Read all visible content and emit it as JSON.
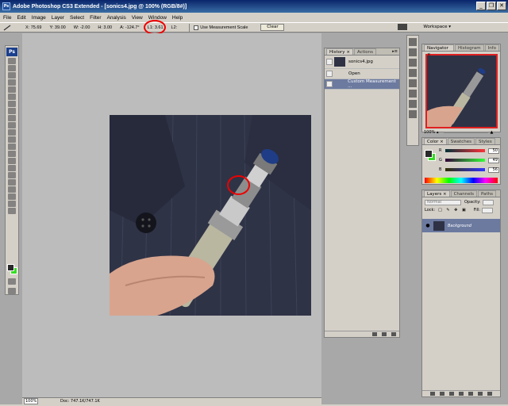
{
  "window": {
    "title": "Adobe Photoshop CS3 Extended - [sonics4.jpg @ 100% (RGB/8#)]",
    "app_icon": "Ps",
    "buttons": [
      "_",
      "❐",
      "✕"
    ]
  },
  "menu": [
    "File",
    "Edit",
    "Image",
    "Layer",
    "Select",
    "Filter",
    "Analysis",
    "View",
    "Window",
    "Help"
  ],
  "options": {
    "x": "X: 75.69",
    "y": "Y: 39.00",
    "w": "W: -2.00",
    "h": "H: 3.00",
    "a": "A: -124.7°",
    "l1": "L1: 3.61",
    "l2": "L2:",
    "use_measurement_scale": "Use Measurement Scale",
    "clear": "Clear",
    "workspace": "Workspace ▾"
  },
  "toolbox": {
    "logo": "Ps",
    "foreground": "#2a2a2a",
    "background": "#33dd22"
  },
  "status": {
    "zoom": "100%",
    "doc": "Doc: 747.1K/747.1K"
  },
  "history": {
    "tabs": [
      "History ×",
      "Actions"
    ],
    "snapshot": "sonics4.jpg",
    "items": [
      "Open",
      "Custom Measurement ..."
    ]
  },
  "navigator": {
    "tabs": [
      "Navigator ×",
      "Histogram",
      "Info"
    ],
    "zoom": "100%"
  },
  "color_panel": {
    "tabs": [
      "Color ×",
      "Swatches",
      "Styles"
    ],
    "r_label": "R",
    "r": "50",
    "g_label": "G",
    "g": "49",
    "b_label": "B",
    "b": "56"
  },
  "layers": {
    "tabs": [
      "Layers ×",
      "Channels",
      "Paths"
    ],
    "blend": "Normal",
    "opacity": "Opacity:",
    "lock": "Lock:",
    "fill": "Fill:",
    "layer_name": "Background"
  }
}
